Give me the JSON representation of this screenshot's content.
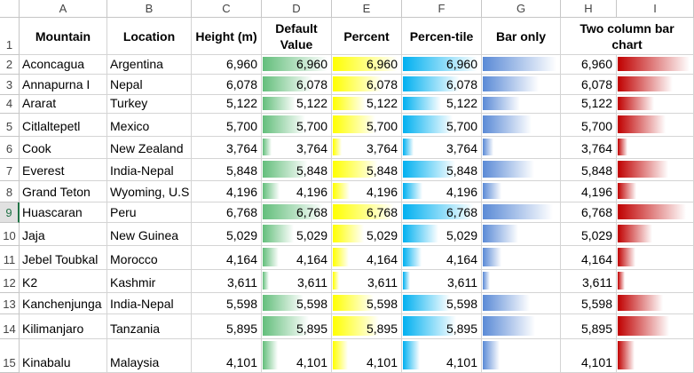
{
  "columns": [
    "A",
    "B",
    "C",
    "D",
    "E",
    "F",
    "G",
    "H",
    "I"
  ],
  "selected_row": 9,
  "headers": {
    "mountain": "Mountain",
    "location": "Location",
    "height": "Height (m)",
    "default": "Default Value",
    "percent": "Percent",
    "percentile": "Percen-tile",
    "bar_only": "Bar only",
    "two_col": "Two column bar chart"
  },
  "colors": {
    "default": "#63be7b",
    "percent": "#ffff00",
    "percentile": "#00b0f0",
    "bar_only": "#5a8ad6",
    "two_col": "#c00000"
  },
  "rows": [
    {
      "n": "2",
      "mountain": "Aconcagua",
      "location": "Argentina",
      "height": "6,960",
      "v": 6960
    },
    {
      "n": "3",
      "mountain": "Annapurna I",
      "location": "Nepal",
      "height": "6,078",
      "v": 6078
    },
    {
      "n": "4",
      "mountain": "Ararat",
      "location": "Turkey",
      "height": "5,122",
      "v": 5122
    },
    {
      "n": "5",
      "mountain": "Citlaltepetl",
      "location": "Mexico",
      "height": "5,700",
      "v": 5700
    },
    {
      "n": "6",
      "mountain": "Cook",
      "location": "New Zealand",
      "height": "3,764",
      "v": 3764
    },
    {
      "n": "7",
      "mountain": "Everest",
      "location": "India-Nepal",
      "height": "5,848",
      "v": 5848
    },
    {
      "n": "8",
      "mountain": "Grand Teton",
      "location": "Wyoming, U.S",
      "height": "4,196",
      "v": 4196
    },
    {
      "n": "9",
      "mountain": "Huascaran",
      "location": "Peru",
      "height": "6,768",
      "v": 6768
    },
    {
      "n": "10",
      "mountain": "Jaja",
      "location": "New Guinea",
      "height": "5,029",
      "v": 5029
    },
    {
      "n": "11",
      "mountain": "Jebel Toubkal",
      "location": "Morocco",
      "height": "4,164",
      "v": 4164
    },
    {
      "n": "12",
      "mountain": "K2",
      "location": "Kashmir",
      "height": "3,611",
      "v": 3611
    },
    {
      "n": "13",
      "mountain": "Kanchenjunga",
      "location": "India-Nepal",
      "height": "5,598",
      "v": 5598
    },
    {
      "n": "14",
      "mountain": "Kilimanjaro",
      "location": "Tanzania",
      "height": "5,895",
      "v": 5895
    },
    {
      "n": "15",
      "mountain": "Kinabalu",
      "location": "Malaysia",
      "height": "4,101",
      "v": 4101
    }
  ]
}
